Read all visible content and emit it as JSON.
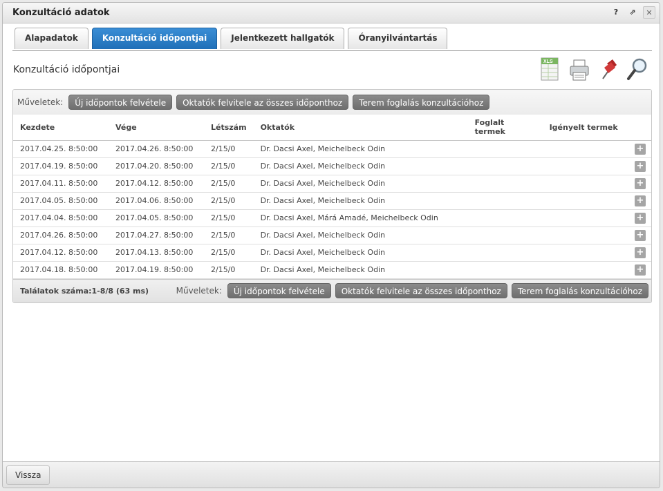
{
  "window": {
    "title": "Konzultáció adatok",
    "help": "?",
    "popout": "⇗",
    "close": "✕"
  },
  "tabs": [
    {
      "label": "Alapadatok",
      "active": false
    },
    {
      "label": "Konzultáció időpontjai",
      "active": true
    },
    {
      "label": "Jelentkezett hallgatók",
      "active": false
    },
    {
      "label": "Óranyilvántartás",
      "active": false
    }
  ],
  "section": {
    "title": "Konzultáció időpontjai",
    "tools": [
      "xls-export-icon",
      "print-icon",
      "pin-icon",
      "search-icon"
    ]
  },
  "ops": {
    "label": "Műveletek:",
    "new_dates": "Új időpontok felvétele",
    "add_teachers": "Oktatók felvitele az összes időponthoz",
    "room_booking": "Terem foglalás konzultációhoz"
  },
  "table": {
    "headers": [
      "Kezdete",
      "Vége",
      "Létszám",
      "Oktatók",
      "Foglalt termek",
      "Igényelt termek"
    ],
    "rows": [
      {
        "start": "2017.04.25. 8:50:00",
        "end": "2017.04.26. 8:50:00",
        "count": "2/15/0",
        "teachers": "Dr. Dacsi Axel, Meichelbeck Odin"
      },
      {
        "start": "2017.04.19. 8:50:00",
        "end": "2017.04.20. 8:50:00",
        "count": "2/15/0",
        "teachers": "Dr. Dacsi Axel, Meichelbeck Odin"
      },
      {
        "start": "2017.04.11. 8:50:00",
        "end": "2017.04.12. 8:50:00",
        "count": "2/15/0",
        "teachers": "Dr. Dacsi Axel, Meichelbeck Odin"
      },
      {
        "start": "2017.04.05. 8:50:00",
        "end": "2017.04.06. 8:50:00",
        "count": "2/15/0",
        "teachers": "Dr. Dacsi Axel, Meichelbeck Odin"
      },
      {
        "start": "2017.04.04. 8:50:00",
        "end": "2017.04.05. 8:50:00",
        "count": "2/15/0",
        "teachers": "Dr. Dacsi Axel, Márá Amadé, Meichelbeck Odin"
      },
      {
        "start": "2017.04.26. 8:50:00",
        "end": "2017.04.27. 8:50:00",
        "count": "2/15/0",
        "teachers": "Dr. Dacsi Axel, Meichelbeck Odin"
      },
      {
        "start": "2017.04.12. 8:50:00",
        "end": "2017.04.13. 8:50:00",
        "count": "2/15/0",
        "teachers": "Dr. Dacsi Axel, Meichelbeck Odin"
      },
      {
        "start": "2017.04.18. 8:50:00",
        "end": "2017.04.19. 8:50:00",
        "count": "2/15/0",
        "teachers": "Dr. Dacsi Axel, Meichelbeck Odin"
      }
    ],
    "plus": "+"
  },
  "results": "Találatok száma:1-8/8 (63 ms)",
  "footer": {
    "back": "Vissza"
  }
}
